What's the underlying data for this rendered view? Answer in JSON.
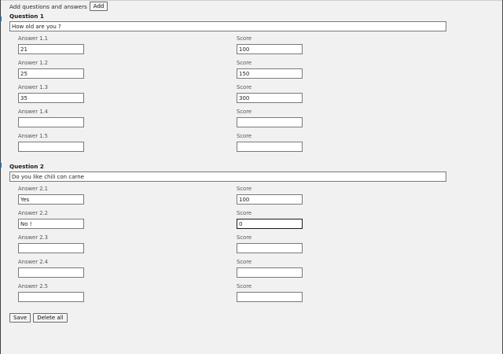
{
  "header": {
    "text": "Add questions and answers",
    "add_button": "Add"
  },
  "questions": [
    {
      "title": "Question 1",
      "value": "How old are you ?",
      "answers": [
        {
          "label": "Answer 1.1",
          "value": "21",
          "score_label": "Score",
          "score": "100"
        },
        {
          "label": "Answer 1.2",
          "value": "25",
          "score_label": "Score",
          "score": "150"
        },
        {
          "label": "Answer 1.3",
          "value": "35",
          "score_label": "Score",
          "score": "300"
        },
        {
          "label": "Answer 1.4",
          "value": "",
          "score_label": "Score",
          "score": ""
        },
        {
          "label": "Answer 1.5",
          "value": "",
          "score_label": "Score",
          "score": ""
        }
      ]
    },
    {
      "title": "Question 2",
      "value": "Do you like chili con carne",
      "answers": [
        {
          "label": "Answer 2.1",
          "value": "Yes",
          "score_label": "Score",
          "score": "100"
        },
        {
          "label": "Answer 2.2",
          "value": "No !",
          "score_label": "Score",
          "score": "0"
        },
        {
          "label": "Answer 2.3",
          "value": "",
          "score_label": "Score",
          "score": ""
        },
        {
          "label": "Answer 2.4",
          "value": "",
          "score_label": "Score",
          "score": ""
        },
        {
          "label": "Answer 2.5",
          "value": "",
          "score_label": "Score",
          "score": ""
        }
      ]
    }
  ],
  "footer": {
    "save_button": "Save",
    "delete_button": "Delete all"
  }
}
